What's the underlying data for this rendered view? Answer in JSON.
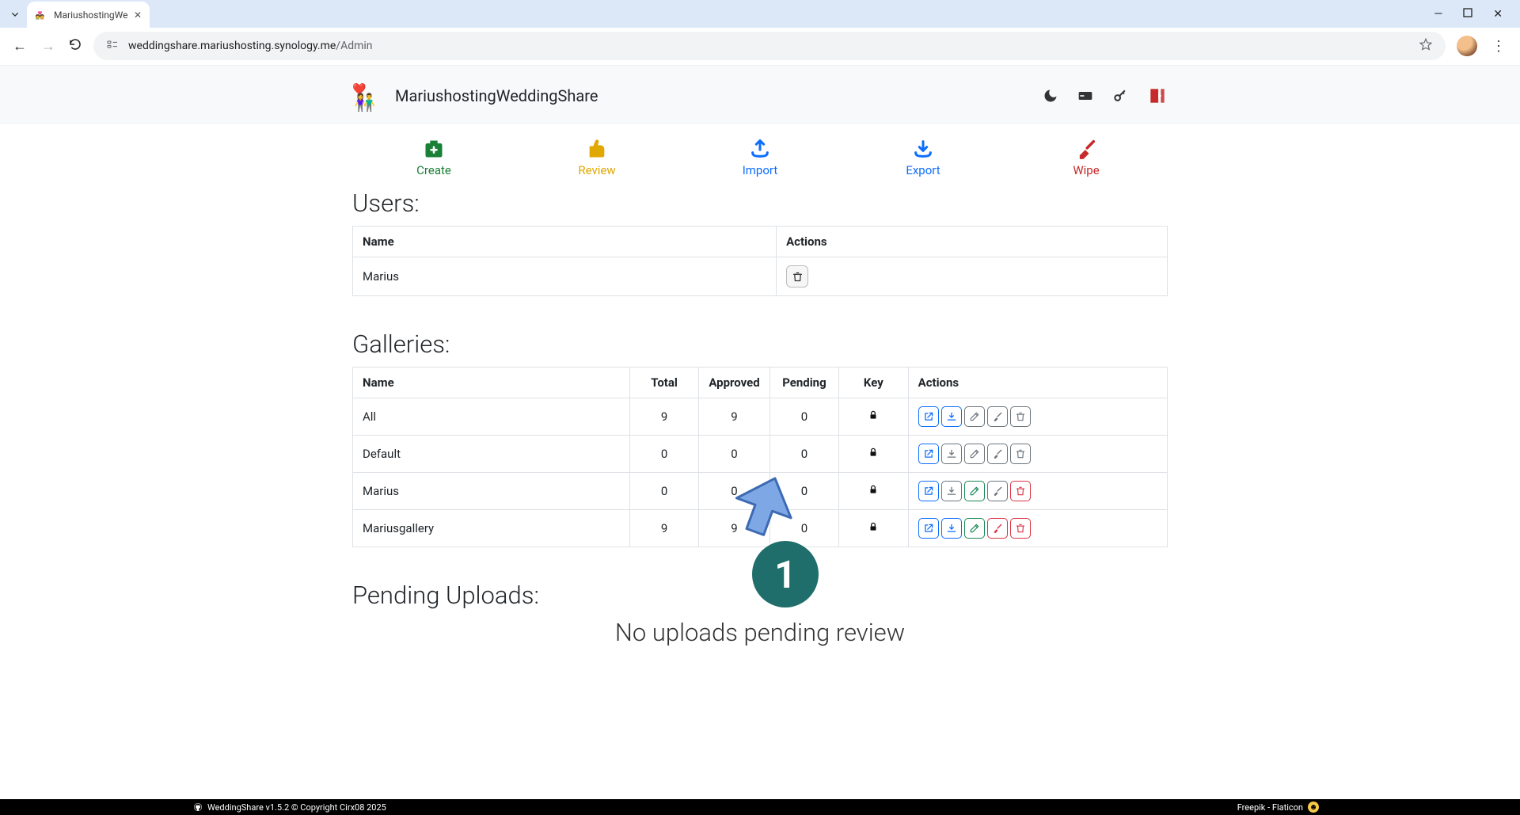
{
  "browser": {
    "tab_title": "MariushostingWe",
    "url_primary": "weddingshare.mariushosting.synology.me",
    "url_path": "/Admin"
  },
  "header": {
    "app_title": "MariushostingWeddingShare"
  },
  "toolbar": {
    "create": "Create",
    "review": "Review",
    "import": "Import",
    "export": "Export",
    "wipe": "Wipe"
  },
  "sections": {
    "users": "Users:",
    "galleries": "Galleries:",
    "pending": "Pending Uploads:"
  },
  "users_table": {
    "cols": {
      "name": "Name",
      "actions": "Actions"
    },
    "rows": [
      {
        "name": "Marius"
      }
    ]
  },
  "galleries_table": {
    "cols": {
      "name": "Name",
      "total": "Total",
      "approved": "Approved",
      "pending": "Pending",
      "key": "Key",
      "actions": "Actions"
    },
    "rows": [
      {
        "name": "All",
        "total": "9",
        "approved": "9",
        "pending": "0",
        "buttons": [
          {
            "c": "blue",
            "icon": "open"
          },
          {
            "c": "blue",
            "icon": "download"
          },
          {
            "c": "gray",
            "icon": "edit"
          },
          {
            "c": "gray",
            "icon": "brush"
          },
          {
            "c": "gray",
            "icon": "trash"
          }
        ]
      },
      {
        "name": "Default",
        "total": "0",
        "approved": "0",
        "pending": "0",
        "buttons": [
          {
            "c": "blue",
            "icon": "open"
          },
          {
            "c": "gray",
            "icon": "download"
          },
          {
            "c": "gray",
            "icon": "edit"
          },
          {
            "c": "gray",
            "icon": "brush"
          },
          {
            "c": "gray",
            "icon": "trash"
          }
        ]
      },
      {
        "name": "Marius",
        "total": "0",
        "approved": "0",
        "pending": "0",
        "buttons": [
          {
            "c": "blue",
            "icon": "open"
          },
          {
            "c": "gray",
            "icon": "download"
          },
          {
            "c": "green",
            "icon": "edit"
          },
          {
            "c": "gray",
            "icon": "brush"
          },
          {
            "c": "red",
            "icon": "trash"
          }
        ]
      },
      {
        "name": "Mariusgallery",
        "total": "9",
        "approved": "9",
        "pending": "0",
        "buttons": [
          {
            "c": "blue",
            "icon": "open"
          },
          {
            "c": "blue",
            "icon": "download"
          },
          {
            "c": "green",
            "icon": "edit"
          },
          {
            "c": "red",
            "icon": "brush"
          },
          {
            "c": "red",
            "icon": "trash"
          }
        ]
      }
    ]
  },
  "pending_msg": "No uploads pending review",
  "annotation_label": "1",
  "footer": {
    "left": "WeddingShare v1.5.2 © Copyright Cirx08 2025",
    "right": "Freepik - Flaticon"
  }
}
